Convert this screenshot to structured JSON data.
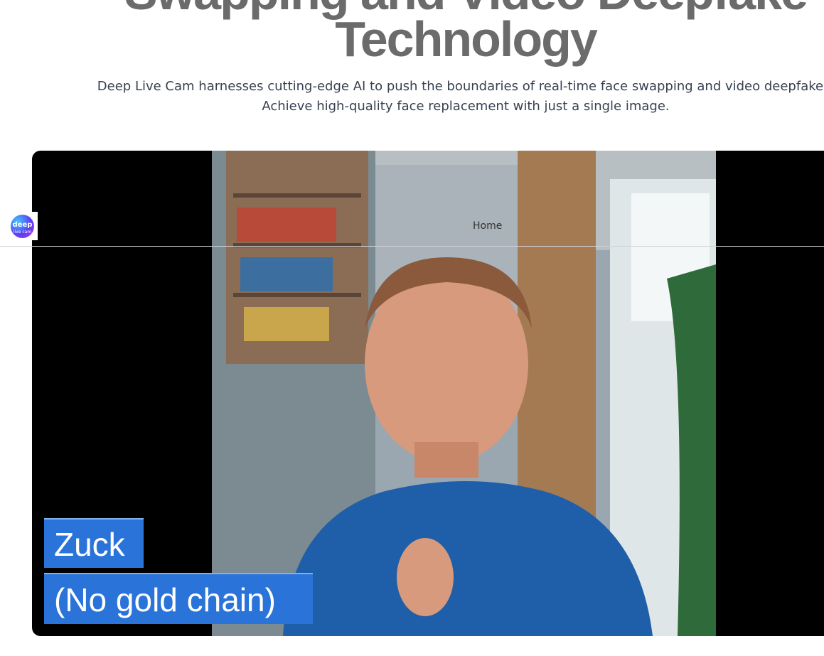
{
  "hero": {
    "title_line1": "Swapping and Video Deepfake",
    "title_line2": "Technology",
    "subtitle_line1": "Deep Live Cam harnesses cutting-edge AI to push the boundaries of real-time face swapping and video deepfakes.",
    "subtitle_line2": "Achieve high-quality face replacement with just a single image."
  },
  "video": {
    "caption_name": "Zuck",
    "caption_note": "(No gold chain)"
  },
  "header": {
    "logo_top": "deep",
    "logo_bottom": "live cam",
    "nav_home": "Home"
  },
  "colors": {
    "caption_blue": "#2a74d9",
    "shirt_blue": "#1f5ea8"
  }
}
